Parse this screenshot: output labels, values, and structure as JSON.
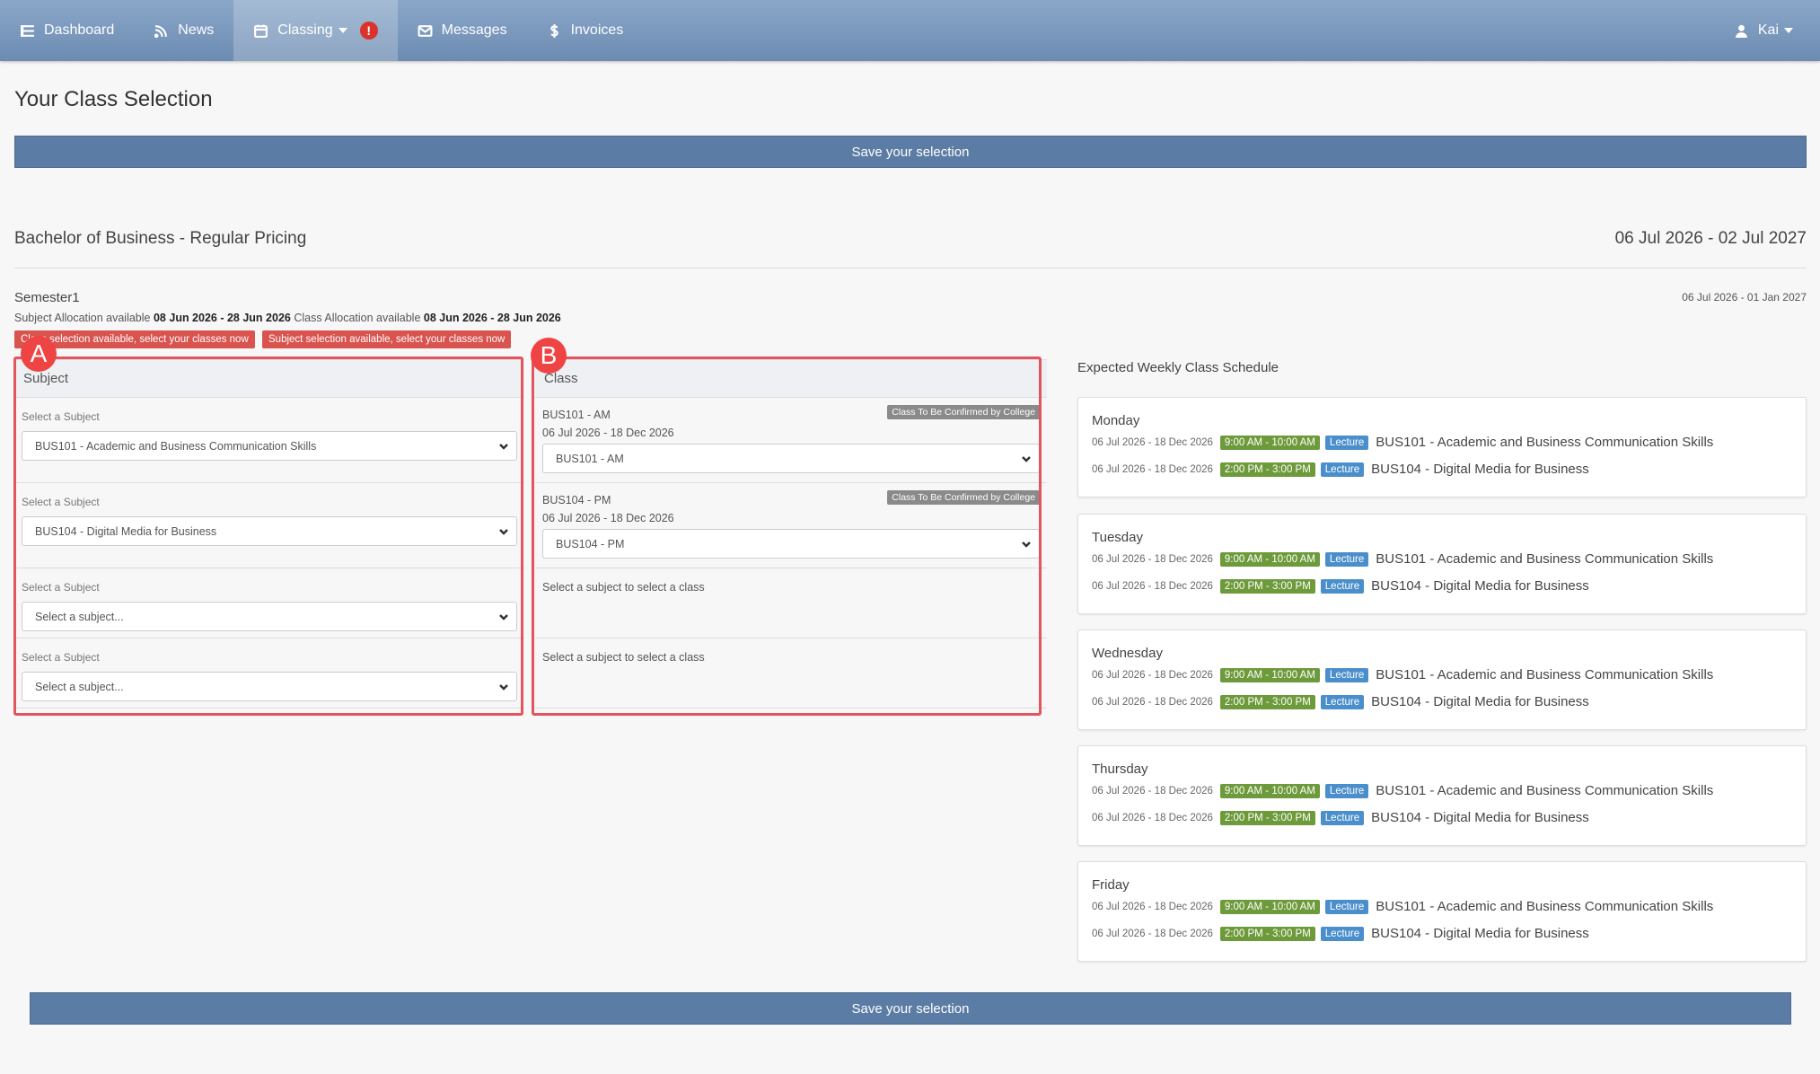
{
  "nav": {
    "dashboard": "Dashboard",
    "news": "News",
    "classing": "Classing",
    "classing_alert": "!",
    "messages": "Messages",
    "invoices": "Invoices",
    "user": "Kai"
  },
  "page": {
    "title": "Your Class Selection",
    "save_label": "Save your selection"
  },
  "program": {
    "name": "Bachelor of Business - Regular Pricing",
    "dates": "06 Jul 2026 - 02 Jul 2027"
  },
  "semester": {
    "name": "Semester1",
    "dates": "06 Jul 2026 - 01 Jan 2027",
    "subject_alloc_label": "Subject Allocation available",
    "subject_alloc_dates": "08 Jun 2026 - 28 Jun 2026",
    "class_alloc_label": "Class Allocation available",
    "class_alloc_dates": "08 Jun 2026 - 28 Jun 2026",
    "pill_1": "Class selection available, select your classes now",
    "pill_2": "Subject selection available, select your classes now"
  },
  "subjects": {
    "header": "Subject",
    "label": "Select a Subject",
    "rows": [
      {
        "value": "BUS101 - Academic and Business Communication Skills"
      },
      {
        "value": "BUS104 - Digital Media for Business"
      },
      {
        "value": "Select a subject..."
      },
      {
        "value": "Select a subject..."
      }
    ]
  },
  "classes": {
    "header": "Class",
    "tbc": "Class To Be Confirmed by College",
    "hint": "Select a subject to select a class",
    "rows": [
      {
        "name": "BUS101 - AM",
        "dates": "06 Jul 2026 - 18 Dec 2026",
        "value": "BUS101 - AM"
      },
      {
        "name": "BUS104 - PM",
        "dates": "06 Jul 2026 - 18 Dec 2026",
        "value": "BUS104 - PM"
      }
    ]
  },
  "annotations": {
    "a": "A",
    "b": "B"
  },
  "schedule": {
    "title": "Expected Weekly Class Schedule",
    "entry_dates": "06 Jul 2026 - 18 Dec 2026",
    "time_1": "9:00 AM - 10:00 AM",
    "time_2": "2:00 PM - 3:00 PM",
    "type": "Lecture",
    "subject_1": "BUS101 - Academic and Business Communication Skills",
    "subject_2": "BUS104 - Digital Media for Business",
    "days": [
      "Monday",
      "Tuesday",
      "Wednesday",
      "Thursday",
      "Friday"
    ]
  },
  "colors": {
    "navbar": "#7896bc",
    "save_button": "#5b7ca4",
    "alert_pill": "#d9534f",
    "time_badge": "#6d9a3a",
    "lecture_badge": "#4a8fcb",
    "annotation": "#e2545e"
  }
}
